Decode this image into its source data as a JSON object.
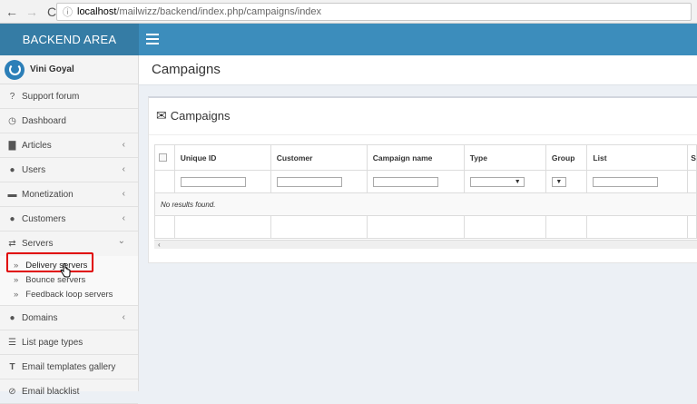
{
  "browser": {
    "back_glyph": "←",
    "forward_glyph": "→",
    "reload_glyph": "C",
    "info_glyph": "ⓘ",
    "url_host": "localhost",
    "url_path": "/mailwizz/backend/index.php/campaigns/index"
  },
  "header": {
    "logo_text": "BACKEND AREA"
  },
  "sidebar": {
    "user_name": "Vini Goyal",
    "items": [
      {
        "label": "Support forum",
        "icon": "question-circle-icon",
        "glyph": "?",
        "chevron": ""
      },
      {
        "label": "Dashboard",
        "icon": "dashboard-icon",
        "glyph": "◷",
        "chevron": ""
      },
      {
        "label": "Articles",
        "icon": "book-icon",
        "glyph": "▇",
        "chevron": "‹"
      },
      {
        "label": "Users",
        "icon": "user-icon",
        "glyph": "●",
        "chevron": "‹"
      },
      {
        "label": "Monetization",
        "icon": "credit-card-icon",
        "glyph": "▬",
        "chevron": "‹"
      },
      {
        "label": "Customers",
        "icon": "user-icon",
        "glyph": "●",
        "chevron": "‹"
      },
      {
        "label": "Servers",
        "icon": "transfer-icon",
        "glyph": "⇄",
        "chevron": "⌄"
      }
    ],
    "submenu": [
      {
        "label": "Delivery servers"
      },
      {
        "label": "Bounce servers"
      },
      {
        "label": "Feedback loop servers"
      }
    ],
    "items_after": [
      {
        "label": "Domains",
        "icon": "globe-icon",
        "glyph": "●",
        "chevron": "‹"
      },
      {
        "label": "List page types",
        "icon": "list-icon",
        "glyph": "☰",
        "chevron": ""
      },
      {
        "label": "Email templates gallery",
        "icon": "text-icon",
        "glyph": "T",
        "chevron": ""
      },
      {
        "label": "Email blacklist",
        "icon": "ban-icon",
        "glyph": "⊘",
        "chevron": ""
      }
    ]
  },
  "content": {
    "page_title": "Campaigns",
    "box_title": "Campaigns",
    "table": {
      "headers": [
        "Unique ID",
        "Customer",
        "Campaign name",
        "Type",
        "Group",
        "List",
        "S"
      ],
      "select_arrow": "▼",
      "empty_text": "No results found."
    },
    "scroll_arrow": "‹"
  }
}
